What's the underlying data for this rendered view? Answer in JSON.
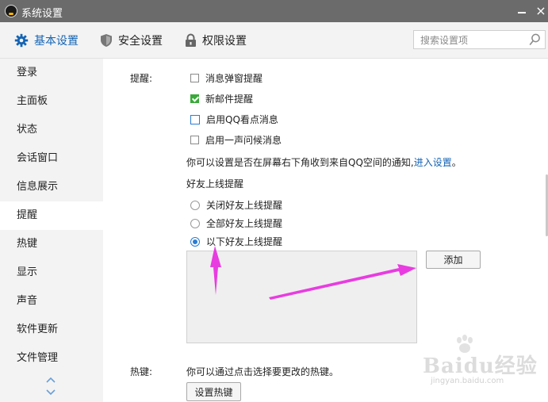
{
  "window": {
    "title": "系统设置",
    "close_glyph": "×"
  },
  "tabs": [
    {
      "label": "基本设置",
      "icon": "gear-icon",
      "active": true
    },
    {
      "label": "安全设置",
      "icon": "shield-icon",
      "active": false
    },
    {
      "label": "权限设置",
      "icon": "lock-icon",
      "active": false
    }
  ],
  "search": {
    "placeholder": "搜索设置项",
    "value": ""
  },
  "sidebar": {
    "items": [
      {
        "label": "登录"
      },
      {
        "label": "主面板"
      },
      {
        "label": "状态"
      },
      {
        "label": "会话窗口"
      },
      {
        "label": "信息展示"
      },
      {
        "label": "提醒",
        "active": true
      },
      {
        "label": "热键"
      },
      {
        "label": "显示"
      },
      {
        "label": "声音"
      },
      {
        "label": "软件更新"
      },
      {
        "label": "文件管理"
      }
    ]
  },
  "reminder": {
    "section_label": "提醒:",
    "options": [
      {
        "label": "消息弹窗提醒",
        "checked": false
      },
      {
        "label": "新邮件提醒",
        "checked": true
      },
      {
        "label": "启用QQ看点消息",
        "checked": false
      },
      {
        "label": "启用一声问候消息",
        "checked": false
      }
    ],
    "notice_text": "你可以设置是否在屏幕右下角收到来自QQ空间的通知,",
    "notice_link": "进入设置",
    "notice_end": "。",
    "friend_online_title": "好友上线提醒",
    "friend_online_options": [
      {
        "label": "关闭好友上线提醒",
        "selected": false
      },
      {
        "label": "全部好友上线提醒",
        "selected": false
      },
      {
        "label": "以下好友上线提醒",
        "selected": true
      }
    ],
    "add_button": "添加"
  },
  "hotkey": {
    "section_label": "热键:",
    "description": "你可以通过点击选择要更改的热键。",
    "button": "设置热键"
  },
  "watermark": {
    "brand": "Baidu经验",
    "url": "jingyan.baidu.com"
  },
  "colors": {
    "accent": "#1464b4",
    "annotation_arrow": "#e83ce0",
    "check_green": "#3aa93a"
  }
}
